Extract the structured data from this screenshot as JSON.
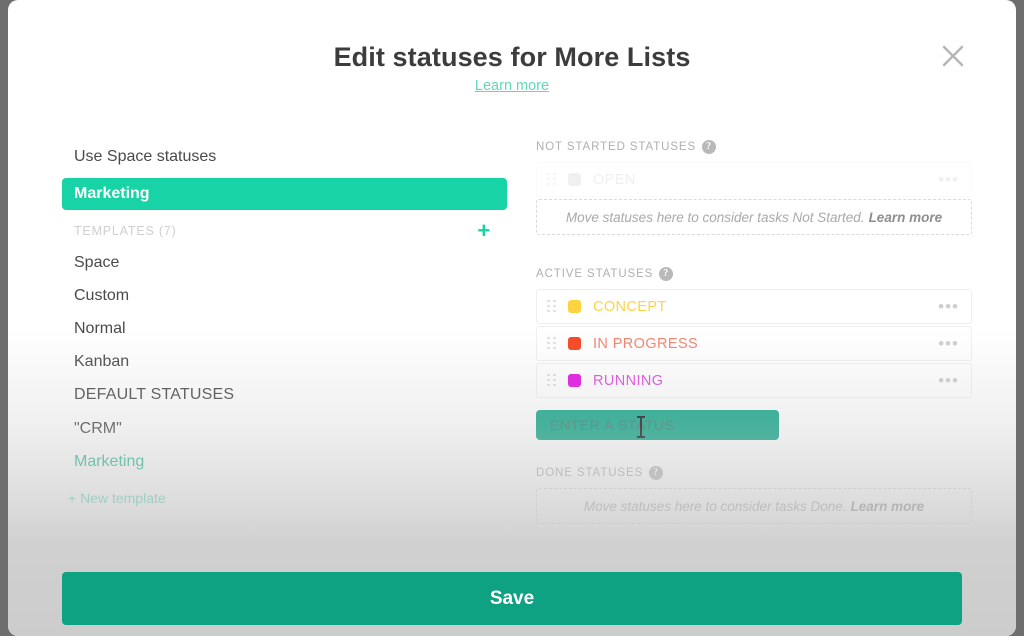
{
  "modal": {
    "title": "Edit statuses for More Lists",
    "learn_more": "Learn more",
    "close_icon": "close-icon"
  },
  "left_panel": {
    "use_space_statuses": "Use Space statuses",
    "selected_template": "Marketing",
    "templates_header": "TEMPLATES (7)",
    "add_template_icon": "+",
    "templates": [
      {
        "label": "Space"
      },
      {
        "label": "Custom"
      },
      {
        "label": "Normal"
      },
      {
        "label": "Kanban"
      }
    ],
    "default_statuses_header": "DEFAULT STATUSES",
    "default_items": [
      {
        "label": "\"CRM\"",
        "teal": false
      },
      {
        "label": "Marketing",
        "teal": true
      }
    ],
    "new_template": "+ New template"
  },
  "right_panel": {
    "not_started": {
      "label": "NOT STARTED STATUSES",
      "help_icon": "help-icon",
      "statuses": [
        {
          "name": "OPEN",
          "color": "#cfcfcf",
          "ghost": true
        }
      ],
      "dropzone_text": "Move statuses here to consider tasks Not Started.",
      "dropzone_link": "Learn more"
    },
    "active": {
      "label": "ACTIVE STATUSES",
      "help_icon": "help-icon",
      "statuses": [
        {
          "name": "CONCEPT",
          "color": "#fdd43f",
          "ghost": false
        },
        {
          "name": "IN PROGRESS",
          "color": "#f74722",
          "ghost": false
        },
        {
          "name": "RUNNING",
          "color": "#e213e2",
          "ghost": false
        }
      ],
      "input_placeholder": "Enter a status",
      "input_value": ""
    },
    "done": {
      "label": "DONE STATUSES",
      "help_icon": "help-icon",
      "dropzone_text": "Move statuses here to consider tasks Done.",
      "dropzone_link": "Learn more"
    },
    "row_menu_icon": "•••"
  },
  "footer": {
    "save_label": "Save"
  },
  "colors": {
    "accent_teal": "#18d3a5",
    "save_green": "#0ea283",
    "input_selection": "#14a88a",
    "concept": "#fdd43f",
    "in_progress": "#f74722",
    "running": "#e213e2"
  }
}
